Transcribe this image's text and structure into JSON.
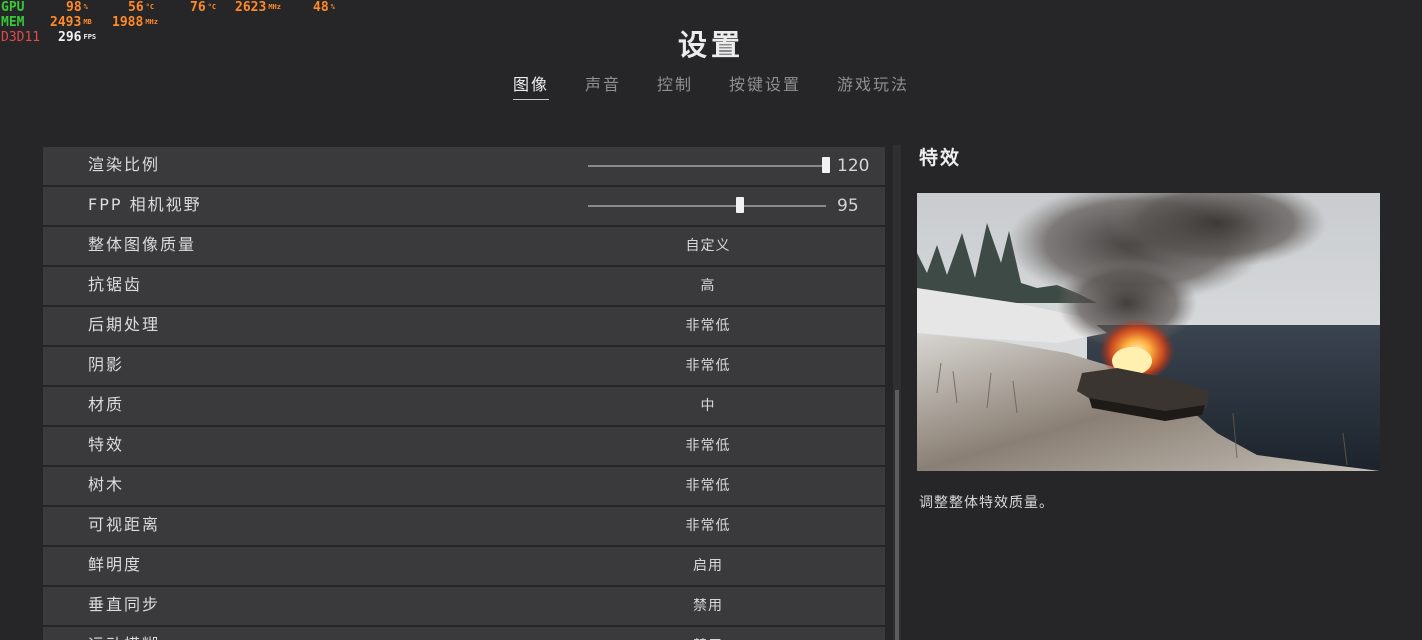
{
  "osd": {
    "gpu_label": "GPU",
    "gpu_load": "98",
    "gpu_load_unit": "%",
    "gpu_temp": "56",
    "gpu_temp_unit": "°C",
    "cpu_temp": "76",
    "cpu_temp_unit": "°C",
    "gpu_clock": "2623",
    "gpu_clock_unit": "MHz",
    "cpu_load": "48",
    "cpu_load_unit": "%",
    "mem_label": "MEM",
    "mem_used": "2493",
    "mem_used_unit": "MB",
    "mem_clock": "1988",
    "mem_clock_unit": "MHz",
    "api_label": "D3D11",
    "fps": "296",
    "fps_unit": "FPS"
  },
  "page": {
    "title": "设置"
  },
  "tabs": [
    {
      "label": "图像",
      "active": true
    },
    {
      "label": "声音",
      "active": false
    },
    {
      "label": "控制",
      "active": false
    },
    {
      "label": "按键设置",
      "active": false
    },
    {
      "label": "游戏玩法",
      "active": false
    }
  ],
  "settings": [
    {
      "label": "渲染比例",
      "type": "slider",
      "value": "120",
      "fraction": 1.0
    },
    {
      "label": "FPP 相机视野",
      "type": "slider",
      "value": "95",
      "fraction": 0.64
    },
    {
      "label": "整体图像质量",
      "type": "option",
      "value": "自定义"
    },
    {
      "label": "抗锯齿",
      "type": "option",
      "value": "高"
    },
    {
      "label": "后期处理",
      "type": "option",
      "value": "非常低"
    },
    {
      "label": "阴影",
      "type": "option",
      "value": "非常低"
    },
    {
      "label": "材质",
      "type": "option",
      "value": "中"
    },
    {
      "label": "特效",
      "type": "option",
      "value": "非常低"
    },
    {
      "label": "树木",
      "type": "option",
      "value": "非常低"
    },
    {
      "label": "可视距离",
      "type": "option",
      "value": "非常低"
    },
    {
      "label": "鲜明度",
      "type": "option",
      "value": "启用"
    },
    {
      "label": "垂直同步",
      "type": "option",
      "value": "禁用"
    },
    {
      "label": "运动模糊",
      "type": "option",
      "value": "禁用"
    }
  ],
  "detail": {
    "title": "特效",
    "description": "调整整体特效质量。"
  }
}
